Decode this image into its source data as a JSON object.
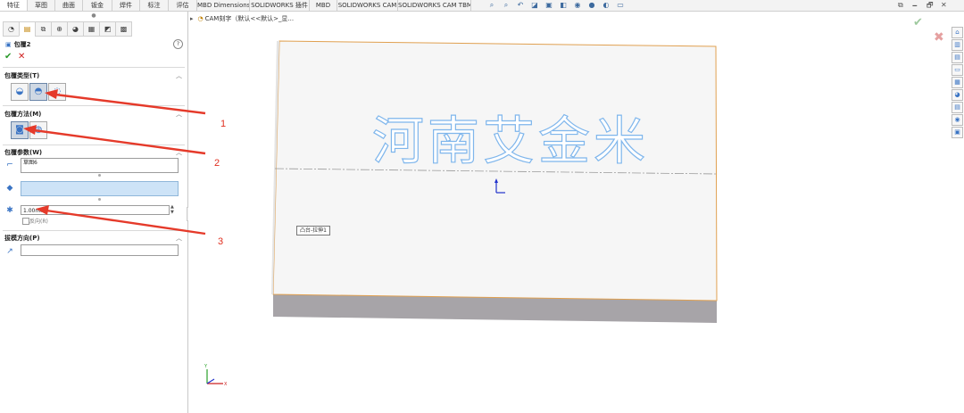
{
  "tabs": [
    {
      "label": "特征",
      "active": true
    },
    {
      "label": "草图"
    },
    {
      "label": "曲面"
    },
    {
      "label": "钣金"
    },
    {
      "label": "焊件"
    },
    {
      "label": "标注"
    },
    {
      "label": "评估"
    },
    {
      "label": "MBD Dimensions"
    },
    {
      "label": "SOLIDWORKS 插件"
    },
    {
      "label": "MBD"
    },
    {
      "label": "SOLIDWORKS CAM"
    },
    {
      "label": "SOLIDWORKS CAM TBM"
    }
  ],
  "window_controls": [
    "⧉",
    "🗕",
    "🗗",
    "✕"
  ],
  "panel": {
    "feature_title": "包覆2",
    "help": "?",
    "ok": "✔",
    "cancel": "✕",
    "sections": {
      "wrap_type": {
        "title": "包覆类型(T)"
      },
      "wrap_method": {
        "title": "包覆方法(M)"
      },
      "wrap_params": {
        "title": "包覆参数(W)",
        "sketch_field": "草图6",
        "face_field": "",
        "thickness": "1.00mm",
        "reverse": "反向(R)"
      },
      "pull_direction": {
        "title": "拔模方向(P)",
        "value": ""
      }
    }
  },
  "tree": {
    "arrow": "▸",
    "text": "CAM刻字（默认<<默认>_显..."
  },
  "tooltip": "凸台-拉伸1",
  "engraving_text": "河南艾金米",
  "annotations": [
    "1",
    "2",
    "3"
  ],
  "confirm": {
    "ok": "✔",
    "cancel": "✖"
  },
  "colors": {
    "arrow": "#e53a2a",
    "engrave": "#7fb6ec",
    "part_edge": "#e0a050",
    "part_face": "#f6f6f6",
    "part_bottom": "#a7a4a8"
  }
}
